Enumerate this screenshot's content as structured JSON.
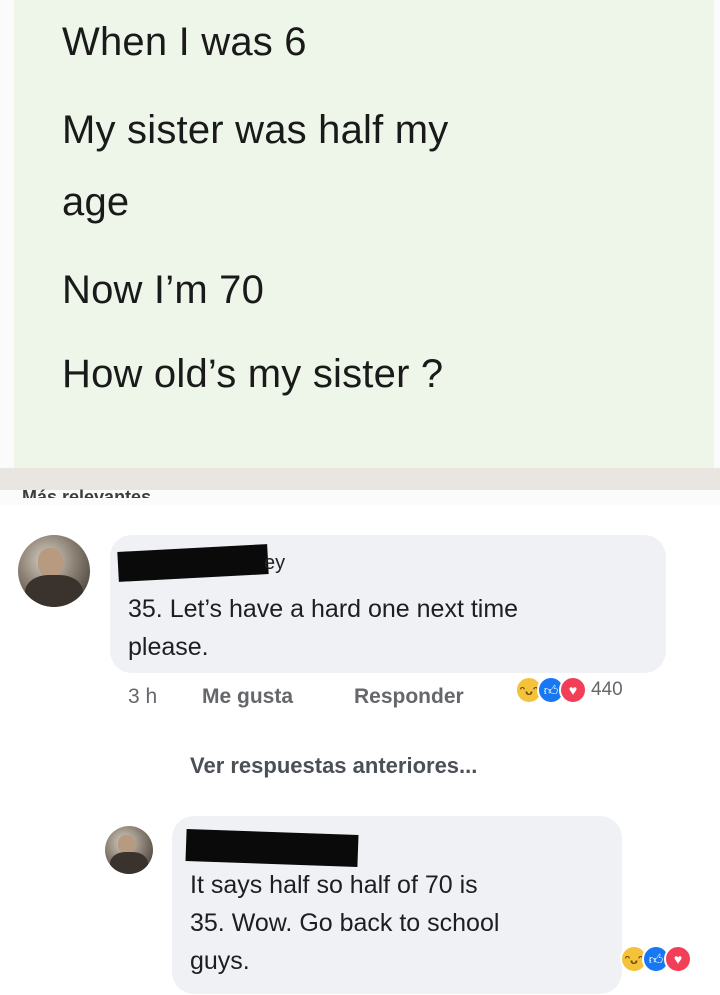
{
  "post": {
    "lines": [
      "When I was 6",
      "My sister was half my",
      "age",
      "Now I’m 70",
      "How old’s my sister ?"
    ]
  },
  "relevant_label": "Más relevantes",
  "comments": [
    {
      "name_visible_fragment": "ey",
      "text_lines": [
        "35. Let’s have a hard one next time",
        "please."
      ],
      "time": "3 h",
      "like_label": "Me gusta",
      "reply_label": "Responder",
      "reaction_count": "440",
      "reactions": [
        "haha",
        "like",
        "love"
      ]
    },
    {
      "text_lines": [
        "It says half so half of 70 is",
        "35. Wow. Go back to school",
        "guys."
      ],
      "reactions": [
        "haha",
        "like",
        "love"
      ]
    }
  ],
  "view_previous_replies": "Ver respuestas anteriores...",
  "icons": {
    "haha": "haha-reaction-icon",
    "like": "like-reaction-icon",
    "love": "love-reaction-icon"
  },
  "colors": {
    "post_background": "#eef6ea",
    "bubble_background": "#eff1f5",
    "like_blue": "#1877f2",
    "love_red": "#f33e58",
    "haha_yellow": "#f5c33b"
  }
}
